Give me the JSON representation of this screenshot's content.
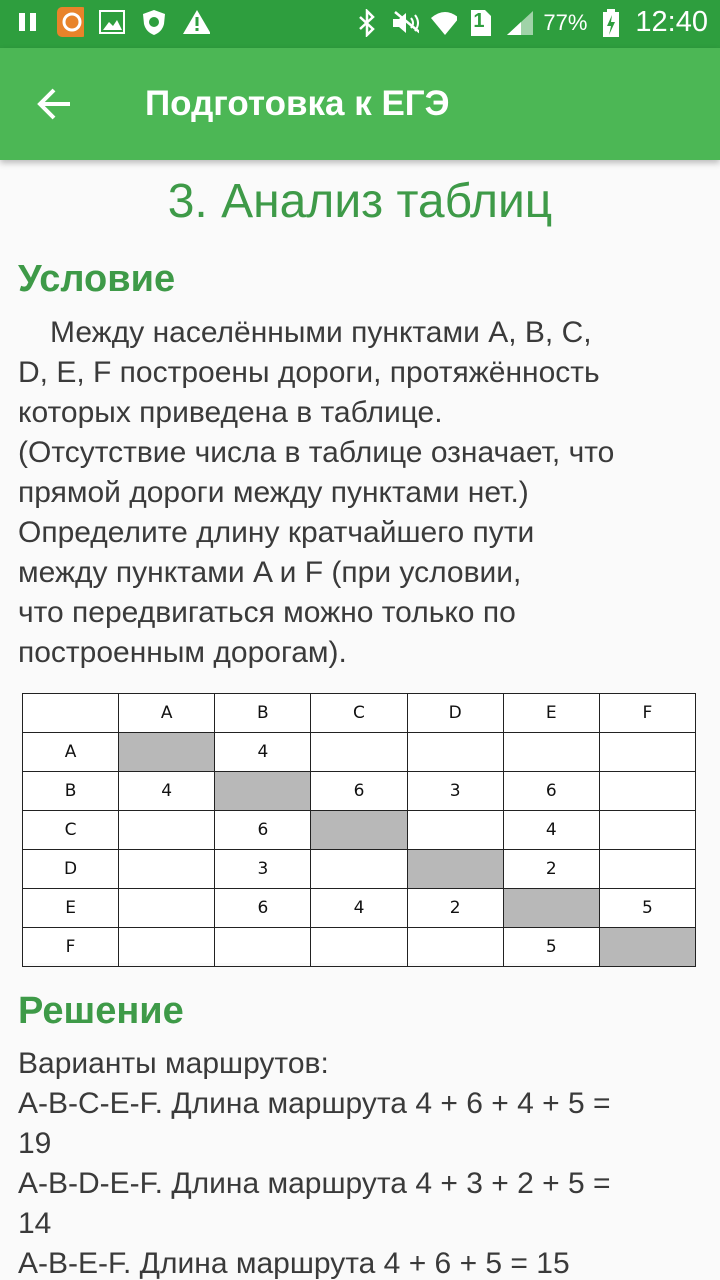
{
  "status_bar": {
    "battery": "77%",
    "time": "12:40",
    "sim_slot": "1",
    "icons": [
      "pause-icon",
      "orange-app-icon",
      "gallery-icon",
      "shield-bug-icon",
      "warning-icon",
      "bluetooth-icon",
      "mute-icon",
      "wifi-icon",
      "sim-icon",
      "signal-icon",
      "battery-icon"
    ]
  },
  "app_bar": {
    "title": "Подготовка к ЕГЭ",
    "back_icon": "arrow-left-icon"
  },
  "page": {
    "title": "3. Анализ таблиц",
    "condition_heading": "Условие",
    "condition_lines": [
      "Между населёнными пунктами A, B, C,",
      "D, E, F построены дороги, протяжённость",
      "которых приведена в таблице.",
      "(Отсутствие числа в таблице означает, что",
      "прямой дороги между пунктами нет.)",
      "Определите длину кратчайшего пути",
      "между пунктами A и F (при условии,",
      "что передвигаться можно только по",
      "построенным дорогам)."
    ],
    "solution_heading": "Решение",
    "solution_lines": [
      "Варианты маршрутов:",
      "A-B-C-E-F. Длина маршрута 4 + 6 + 4 + 5 =",
      "19",
      "A-B-D-E-F. Длина маршрута 4 + 3 + 2 + 5 =",
      "14",
      "A-B-E-F. Длина маршрута 4 + 6 + 5 = 15"
    ]
  },
  "table": {
    "headers": [
      "",
      "A",
      "B",
      "C",
      "D",
      "E",
      "F"
    ],
    "rows": [
      [
        "A",
        "",
        "4",
        "",
        "",
        "",
        ""
      ],
      [
        "B",
        "4",
        "",
        "6",
        "3",
        "6",
        ""
      ],
      [
        "C",
        "",
        "6",
        "",
        "",
        "4",
        ""
      ],
      [
        "D",
        "",
        "3",
        "",
        "",
        "2",
        ""
      ],
      [
        "E",
        "",
        "6",
        "4",
        "2",
        "",
        "5"
      ],
      [
        "F",
        "",
        "",
        "",
        "",
        "5",
        ""
      ]
    ]
  }
}
